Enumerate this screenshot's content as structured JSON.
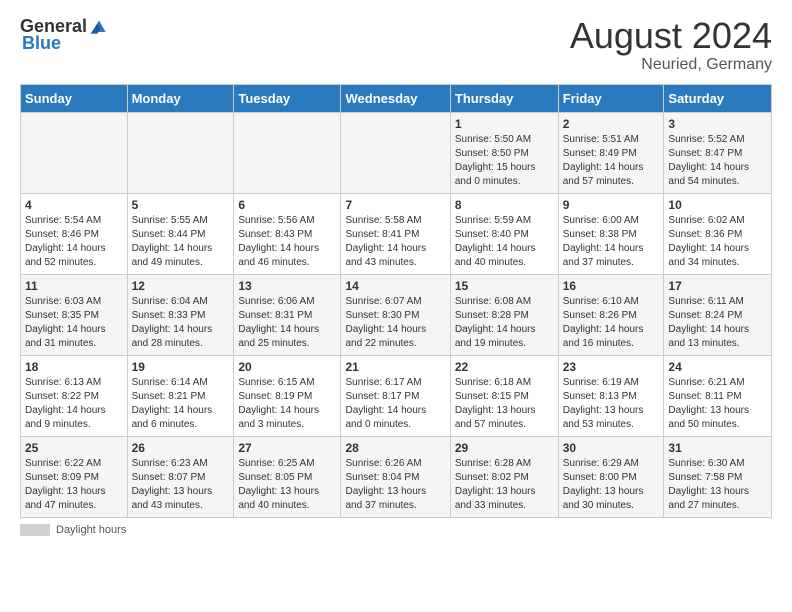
{
  "header": {
    "logo_general": "General",
    "logo_blue": "Blue",
    "month_year": "August 2024",
    "location": "Neuried, Germany"
  },
  "columns": [
    "Sunday",
    "Monday",
    "Tuesday",
    "Wednesday",
    "Thursday",
    "Friday",
    "Saturday"
  ],
  "footer": {
    "label": "Daylight hours"
  },
  "weeks": [
    [
      {
        "day": "",
        "info": ""
      },
      {
        "day": "",
        "info": ""
      },
      {
        "day": "",
        "info": ""
      },
      {
        "day": "",
        "info": ""
      },
      {
        "day": "1",
        "info": "Sunrise: 5:50 AM\nSunset: 8:50 PM\nDaylight: 15 hours\nand 0 minutes."
      },
      {
        "day": "2",
        "info": "Sunrise: 5:51 AM\nSunset: 8:49 PM\nDaylight: 14 hours\nand 57 minutes."
      },
      {
        "day": "3",
        "info": "Sunrise: 5:52 AM\nSunset: 8:47 PM\nDaylight: 14 hours\nand 54 minutes."
      }
    ],
    [
      {
        "day": "4",
        "info": "Sunrise: 5:54 AM\nSunset: 8:46 PM\nDaylight: 14 hours\nand 52 minutes."
      },
      {
        "day": "5",
        "info": "Sunrise: 5:55 AM\nSunset: 8:44 PM\nDaylight: 14 hours\nand 49 minutes."
      },
      {
        "day": "6",
        "info": "Sunrise: 5:56 AM\nSunset: 8:43 PM\nDaylight: 14 hours\nand 46 minutes."
      },
      {
        "day": "7",
        "info": "Sunrise: 5:58 AM\nSunset: 8:41 PM\nDaylight: 14 hours\nand 43 minutes."
      },
      {
        "day": "8",
        "info": "Sunrise: 5:59 AM\nSunset: 8:40 PM\nDaylight: 14 hours\nand 40 minutes."
      },
      {
        "day": "9",
        "info": "Sunrise: 6:00 AM\nSunset: 8:38 PM\nDaylight: 14 hours\nand 37 minutes."
      },
      {
        "day": "10",
        "info": "Sunrise: 6:02 AM\nSunset: 8:36 PM\nDaylight: 14 hours\nand 34 minutes."
      }
    ],
    [
      {
        "day": "11",
        "info": "Sunrise: 6:03 AM\nSunset: 8:35 PM\nDaylight: 14 hours\nand 31 minutes."
      },
      {
        "day": "12",
        "info": "Sunrise: 6:04 AM\nSunset: 8:33 PM\nDaylight: 14 hours\nand 28 minutes."
      },
      {
        "day": "13",
        "info": "Sunrise: 6:06 AM\nSunset: 8:31 PM\nDaylight: 14 hours\nand 25 minutes."
      },
      {
        "day": "14",
        "info": "Sunrise: 6:07 AM\nSunset: 8:30 PM\nDaylight: 14 hours\nand 22 minutes."
      },
      {
        "day": "15",
        "info": "Sunrise: 6:08 AM\nSunset: 8:28 PM\nDaylight: 14 hours\nand 19 minutes."
      },
      {
        "day": "16",
        "info": "Sunrise: 6:10 AM\nSunset: 8:26 PM\nDaylight: 14 hours\nand 16 minutes."
      },
      {
        "day": "17",
        "info": "Sunrise: 6:11 AM\nSunset: 8:24 PM\nDaylight: 14 hours\nand 13 minutes."
      }
    ],
    [
      {
        "day": "18",
        "info": "Sunrise: 6:13 AM\nSunset: 8:22 PM\nDaylight: 14 hours\nand 9 minutes."
      },
      {
        "day": "19",
        "info": "Sunrise: 6:14 AM\nSunset: 8:21 PM\nDaylight: 14 hours\nand 6 minutes."
      },
      {
        "day": "20",
        "info": "Sunrise: 6:15 AM\nSunset: 8:19 PM\nDaylight: 14 hours\nand 3 minutes."
      },
      {
        "day": "21",
        "info": "Sunrise: 6:17 AM\nSunset: 8:17 PM\nDaylight: 14 hours\nand 0 minutes."
      },
      {
        "day": "22",
        "info": "Sunrise: 6:18 AM\nSunset: 8:15 PM\nDaylight: 13 hours\nand 57 minutes."
      },
      {
        "day": "23",
        "info": "Sunrise: 6:19 AM\nSunset: 8:13 PM\nDaylight: 13 hours\nand 53 minutes."
      },
      {
        "day": "24",
        "info": "Sunrise: 6:21 AM\nSunset: 8:11 PM\nDaylight: 13 hours\nand 50 minutes."
      }
    ],
    [
      {
        "day": "25",
        "info": "Sunrise: 6:22 AM\nSunset: 8:09 PM\nDaylight: 13 hours\nand 47 minutes."
      },
      {
        "day": "26",
        "info": "Sunrise: 6:23 AM\nSunset: 8:07 PM\nDaylight: 13 hours\nand 43 minutes."
      },
      {
        "day": "27",
        "info": "Sunrise: 6:25 AM\nSunset: 8:05 PM\nDaylight: 13 hours\nand 40 minutes."
      },
      {
        "day": "28",
        "info": "Sunrise: 6:26 AM\nSunset: 8:04 PM\nDaylight: 13 hours\nand 37 minutes."
      },
      {
        "day": "29",
        "info": "Sunrise: 6:28 AM\nSunset: 8:02 PM\nDaylight: 13 hours\nand 33 minutes."
      },
      {
        "day": "30",
        "info": "Sunrise: 6:29 AM\nSunset: 8:00 PM\nDaylight: 13 hours\nand 30 minutes."
      },
      {
        "day": "31",
        "info": "Sunrise: 6:30 AM\nSunset: 7:58 PM\nDaylight: 13 hours\nand 27 minutes."
      }
    ]
  ]
}
